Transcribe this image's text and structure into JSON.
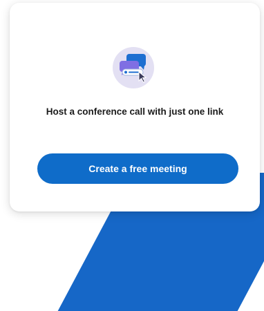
{
  "card": {
    "icon": "chat-bubbles-link-cursor-icon",
    "headline": "Host a conference call with just one link",
    "cta_label": "Create a free meeting"
  },
  "colors": {
    "button": "#0f6cc9",
    "background_shape": "#1667c7",
    "icon_circle": "#e3e0f3",
    "bubble_blue": "#1e6fd1",
    "bubble_purple": "#7f6fe3"
  }
}
